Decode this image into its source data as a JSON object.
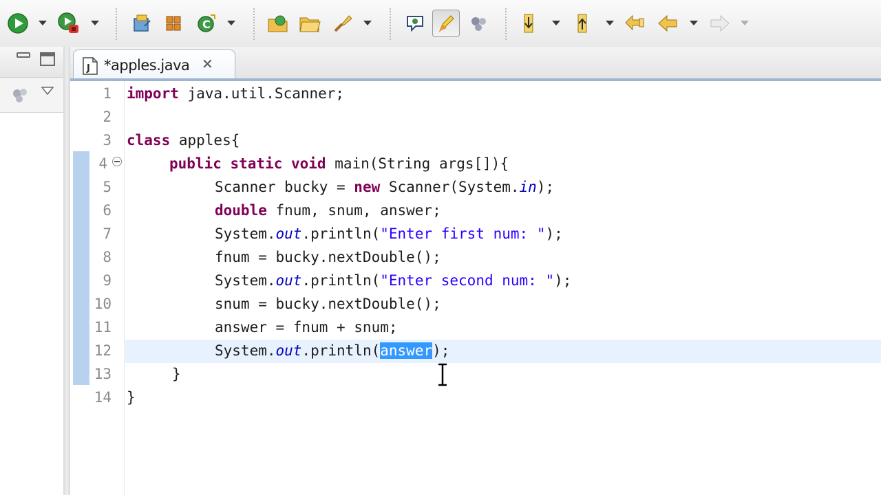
{
  "editor": {
    "tab_title": "*apples.java",
    "tab_close": "✕",
    "lines": [
      {
        "num": "1"
      },
      {
        "num": "2"
      },
      {
        "num": "3"
      },
      {
        "num": "4"
      },
      {
        "num": "5"
      },
      {
        "num": "6"
      },
      {
        "num": "7"
      },
      {
        "num": "8"
      },
      {
        "num": "9"
      },
      {
        "num": "10"
      },
      {
        "num": "11"
      },
      {
        "num": "12"
      },
      {
        "num": "13"
      },
      {
        "num": "14"
      }
    ],
    "code": {
      "l1_kw": "import",
      "l1_rest": " java.util.Scanner;",
      "l3_kw": "class",
      "l3_rest": " apples{",
      "l4_kw": "public static void",
      "l4_rest": " main(String args[]){",
      "l5_a": "Scanner bucky = ",
      "l5_kw": "new",
      "l5_b": " Scanner(System.",
      "l5_fld": "in",
      "l5_c": ");",
      "l6_kw": "double",
      "l6_rest": " fnum, snum, answer;",
      "l7_a": "System.",
      "l7_fld": "out",
      "l7_b": ".println(",
      "l7_str": "\"Enter first num: \"",
      "l7_c": ");",
      "l8": "fnum = bucky.nextDouble();",
      "l9_a": "System.",
      "l9_fld": "out",
      "l9_b": ".println(",
      "l9_str": "\"Enter second num: \"",
      "l9_c": ");",
      "l10": "snum = bucky.nextDouble();",
      "l11": "answer = fnum + snum;",
      "l12_a": "System.",
      "l12_fld": "out",
      "l12_b": ".println(",
      "l12_sel": "answer",
      "l12_c": ");",
      "l13": "}",
      "l14": "}"
    }
  },
  "toolbar": {
    "icons": [
      "run-icon",
      "debug-icon",
      "new-java-project-icon",
      "new-package-icon",
      "new-class-icon",
      "open-type-icon",
      "open-folder-icon",
      "search-icon",
      "toggle-breakpoint-icon",
      "mark-occurrences-icon",
      "toggle-whitespace-icon",
      "next-annotation-icon",
      "previous-annotation-icon",
      "last-edit-icon",
      "back-icon",
      "forward-icon"
    ]
  },
  "colors": {
    "keyword": "#7f0055",
    "string": "#2a00ff",
    "field": "#0000c0",
    "selection": "#3399ff",
    "current_line": "#e8f2fe",
    "change_bar": "#b6d2ee"
  }
}
